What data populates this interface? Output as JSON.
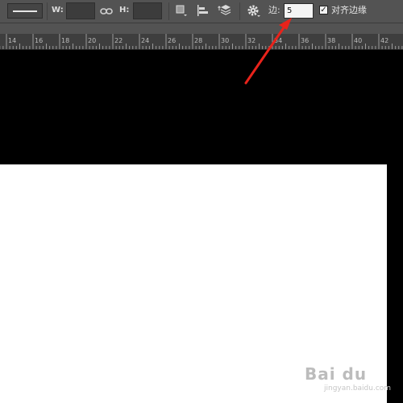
{
  "toolbar": {
    "stroke_type": "stroke-line-swatch",
    "width_label": "W:",
    "width_value": "",
    "link_icon": "link-icon",
    "height_label": "H:",
    "height_value": "",
    "path_ops_icon": "path-operations-icon",
    "path_align_icon": "path-alignment-icon",
    "path_arrange_icon": "path-arrangement-icon",
    "gear_icon": "gear-icon",
    "edge_label": "边:",
    "edge_value": "5",
    "align_edges_checked": true,
    "align_edges_label": "对齐边缘"
  },
  "ruler": {
    "labels": [
      "14",
      "16",
      "18",
      "20",
      "22",
      "24",
      "26",
      "28",
      "30",
      "32",
      "34",
      "36",
      "38",
      "40",
      "42"
    ]
  },
  "annotation": {
    "color": "#e8231b"
  },
  "watermark": {
    "brand": "Bai du",
    "sub": "jingyan.baidu.com"
  }
}
